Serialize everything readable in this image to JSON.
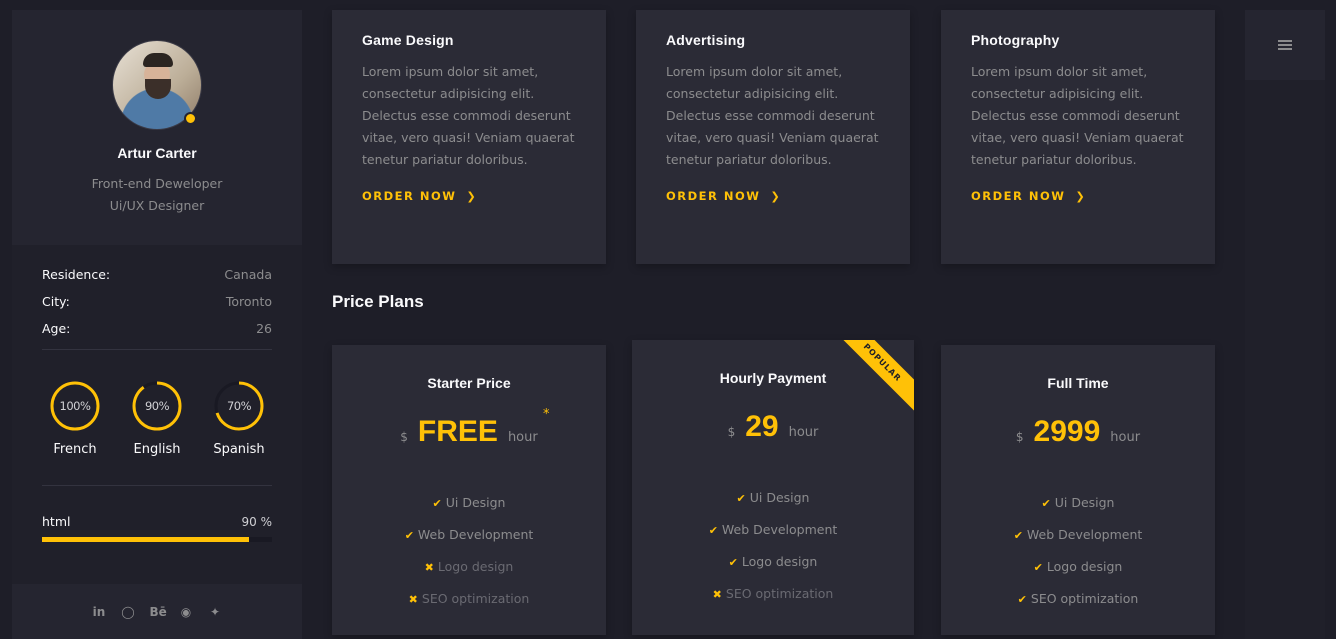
{
  "profile": {
    "name": "Artur Carter",
    "role_line1": "Front-end Deweloper",
    "role_line2": "Ui/UX Designer"
  },
  "info": [
    {
      "key": "Residence:",
      "value": "Canada"
    },
    {
      "key": "City:",
      "value": "Toronto"
    },
    {
      "key": "Age:",
      "value": "26"
    }
  ],
  "languages": [
    {
      "name": "French",
      "label": "100%",
      "percent": 100
    },
    {
      "name": "English",
      "label": "90%",
      "percent": 90
    },
    {
      "name": "Spanish",
      "label": "70%",
      "percent": 70
    }
  ],
  "skills": [
    {
      "name": "html",
      "label": "90 %",
      "percent": 90
    }
  ],
  "social_icons": [
    "linkedin-icon",
    "dribbble-icon",
    "behance-icon",
    "github-icon",
    "twitter-icon"
  ],
  "social_behance_text": "Bē",
  "services": [
    {
      "title": "Game Design",
      "text": "Lorem ipsum dolor sit amet, consectetur adipisicing elit. Delectus esse commodi deserunt vitae, vero quasi! Veniam quaerat tenetur pariatur doloribus.",
      "cta": "ORDER NOW"
    },
    {
      "title": "Advertising",
      "text": "Lorem ipsum dolor sit amet, consectetur adipisicing elit. Delectus esse commodi deserunt vitae, vero quasi! Veniam quaerat tenetur pariatur doloribus.",
      "cta": "ORDER NOW"
    },
    {
      "title": "Photography",
      "text": "Lorem ipsum dolor sit amet, consectetur adipisicing elit. Delectus esse commodi deserunt vitae, vero quasi! Veniam quaerat tenetur pariatur doloribus.",
      "cta": "ORDER NOW"
    }
  ],
  "price_section_title": "Price Plans",
  "plans": [
    {
      "title": "Starter Price",
      "currency": "$",
      "amount": "FREE",
      "unit": "hour",
      "note": "*",
      "features": [
        {
          "text": "Ui Design",
          "included": true
        },
        {
          "text": "Web Development",
          "included": true
        },
        {
          "text": "Logo design",
          "included": false
        },
        {
          "text": "SEO optimization",
          "included": false
        }
      ]
    },
    {
      "title": "Hourly Payment",
      "currency": "$",
      "amount": "29",
      "unit": "hour",
      "badge": "POPULAR",
      "features": [
        {
          "text": "Ui Design",
          "included": true
        },
        {
          "text": "Web Development",
          "included": true
        },
        {
          "text": "Logo design",
          "included": true
        },
        {
          "text": "SEO optimization",
          "included": false
        }
      ]
    },
    {
      "title": "Full Time",
      "currency": "$",
      "amount": "2999",
      "unit": "hour",
      "features": [
        {
          "text": "Ui Design",
          "included": true
        },
        {
          "text": "Web Development",
          "included": true
        },
        {
          "text": "Logo design",
          "included": true
        },
        {
          "text": "SEO optimization",
          "included": true
        }
      ]
    }
  ],
  "colors": {
    "accent": "#ffc107",
    "background": "#1e1e28",
    "card": "#2b2b36",
    "text": "#8c8c8e",
    "heading": "#fafafc"
  },
  "icons": {
    "menu": "hamburger-menu-icon",
    "check": "check-icon",
    "cross": "cross-icon",
    "chevron": "chevron-right-icon"
  }
}
